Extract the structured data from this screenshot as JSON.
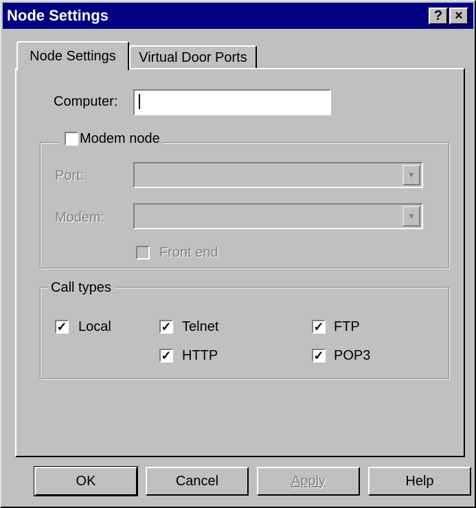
{
  "window": {
    "title": "Node Settings",
    "help_button": "?",
    "close_button": "×"
  },
  "tabs": [
    {
      "label": "Node Settings",
      "active": true
    },
    {
      "label": "Virtual Door Ports",
      "active": false
    }
  ],
  "computer": {
    "label": "Computer:",
    "value": ""
  },
  "modem_node": {
    "label": "Modem node",
    "checked": false,
    "port_label": "Port:",
    "port_value": "",
    "modem_label": "Modem:",
    "modem_value": "",
    "front_end_label": "Front end",
    "front_end_checked": false
  },
  "call_types": {
    "legend": "Call types",
    "local": {
      "label": "Local",
      "checked": "✓"
    },
    "telnet": {
      "label": "Telnet",
      "checked": "✓"
    },
    "ftp": {
      "label": "FTP",
      "checked": "✓"
    },
    "http": {
      "label": "HTTP",
      "checked": "✓"
    },
    "pop3": {
      "label": "POP3",
      "checked": "✓"
    }
  },
  "buttons": {
    "ok": "OK",
    "cancel": "Cancel",
    "apply": "Apply",
    "help": "Help"
  },
  "icons": {
    "dropdown_arrow": "▼"
  }
}
